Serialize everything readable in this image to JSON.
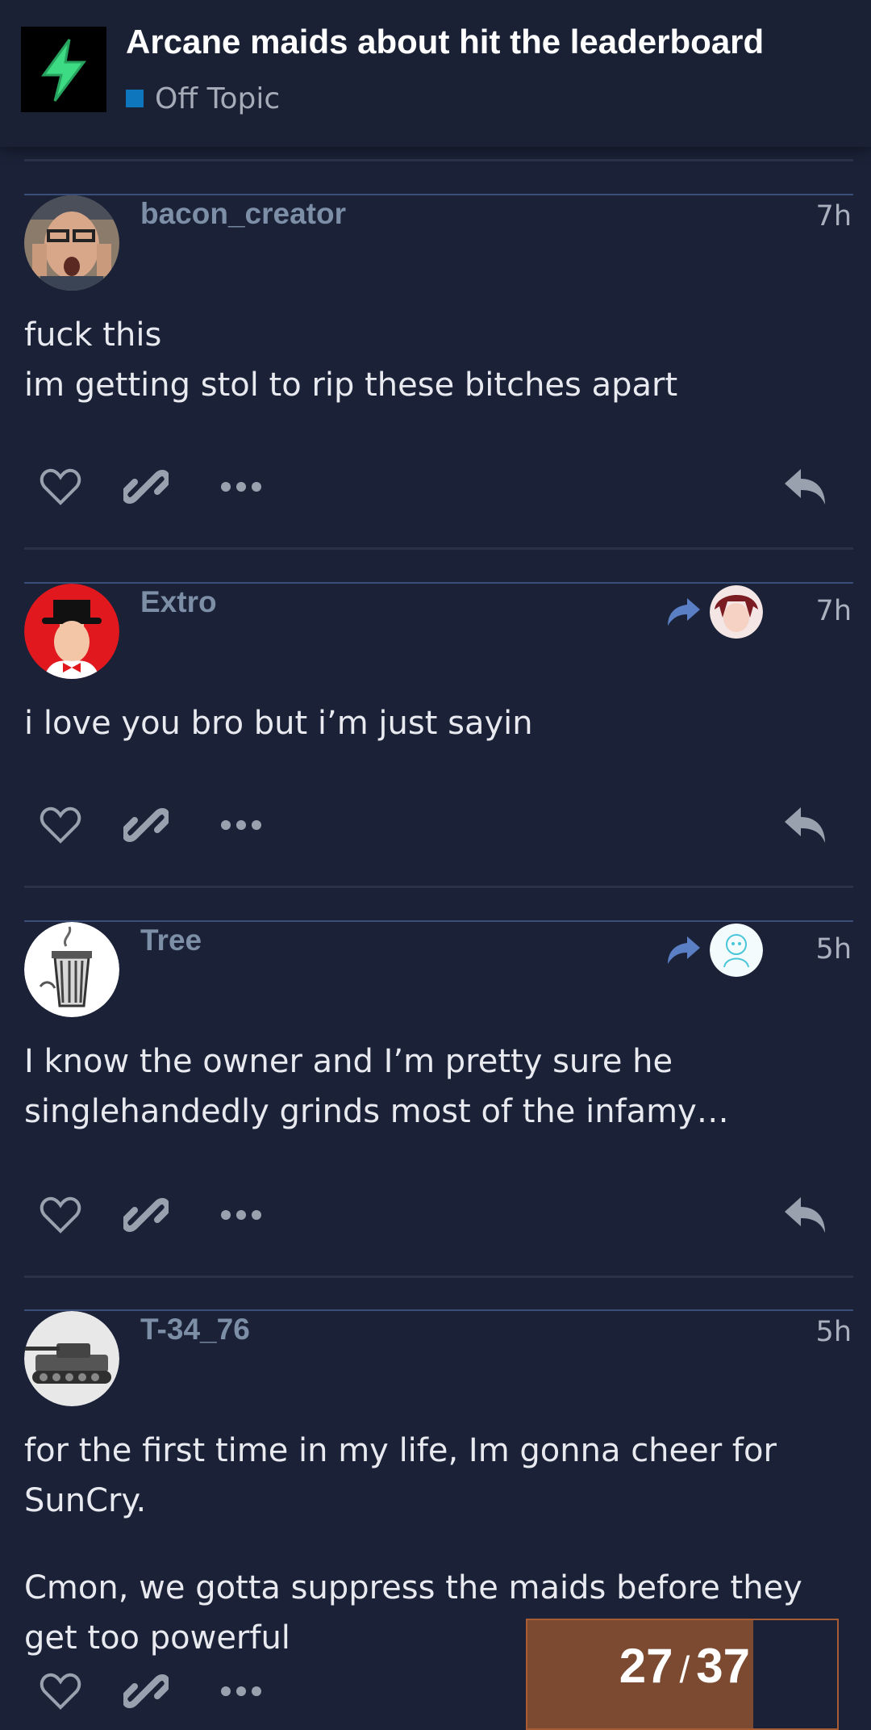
{
  "header": {
    "title": "Arcane maids about hit the leaderboard",
    "category": "Off Topic",
    "category_color": "#0e76bd",
    "logo_icon": "lightning-bolt-icon"
  },
  "posts": [
    {
      "username": "bacon_creator",
      "time": "7h",
      "reply_to": false,
      "body": [
        "fuck this",
        "im getting stol to rip these bitches apart"
      ]
    },
    {
      "username": "Extro",
      "time": "7h",
      "reply_to": true,
      "body": [
        "i love you bro but i’m just sayin"
      ]
    },
    {
      "username": "Tree",
      "time": "5h",
      "reply_to": true,
      "body": [
        "I know the owner and I’m pretty sure he singlehandedly grinds most of the infamy…"
      ]
    },
    {
      "username": "T-34_76",
      "time": "5h",
      "reply_to": false,
      "body": [
        "for the first time in my life, Im gonna cheer for SunCry.",
        "Cmon, we gotta suppress the maids before they get too powerful"
      ]
    }
  ],
  "actions": {
    "like_icon": "heart-icon",
    "link_icon": "link-icon",
    "more_icon": "more-icon",
    "reply_icon": "reply-icon"
  },
  "progress": {
    "current": "27",
    "separator": "/",
    "total": "37",
    "fraction": 0.73
  },
  "colors": {
    "background": "#1b2238",
    "username": "#7d8fa7",
    "progress_fill": "#7b4a31",
    "reply_arrow": "#5b7fc4"
  }
}
